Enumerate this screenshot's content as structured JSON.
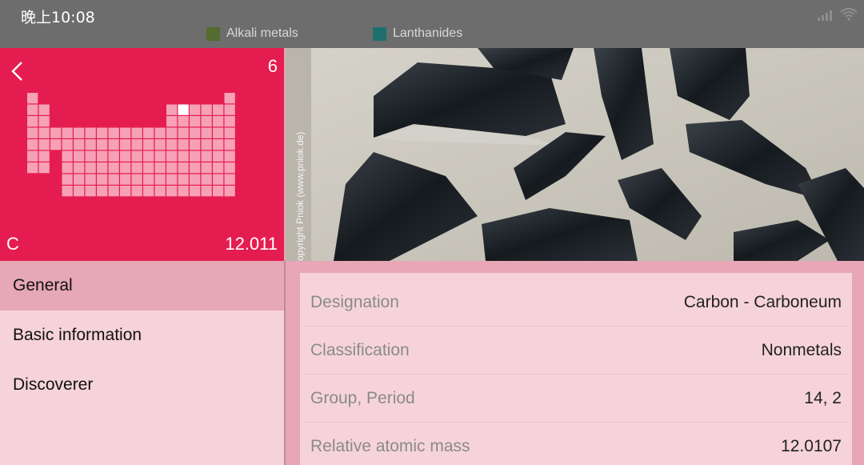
{
  "status": {
    "time": "晚上10:08"
  },
  "legend": [
    {
      "label": "Alkali metals",
      "color": "#556b2f"
    },
    {
      "label": "Lanthanides",
      "color": "#1f6f6f"
    }
  ],
  "element": {
    "number": "6",
    "symbol": "C",
    "mass": "12.011"
  },
  "photo": {
    "caption": "opyright Pniok (www.pniok.de)"
  },
  "nav": [
    {
      "label": "General",
      "active": true
    },
    {
      "label": "Basic information",
      "active": false
    },
    {
      "label": "Discoverer",
      "active": false
    }
  ],
  "details": [
    {
      "label": "Designation",
      "value": "Carbon - Carboneum"
    },
    {
      "label": "Classification",
      "value": "Nonmetals"
    },
    {
      "label": "Group, Period",
      "value": "14, 2"
    },
    {
      "label": "Relative atomic mass",
      "value": "12.0107"
    }
  ],
  "colors": {
    "accent": "#e51c4f",
    "panel": "#f6d3db",
    "active": "#e6a7b6"
  }
}
